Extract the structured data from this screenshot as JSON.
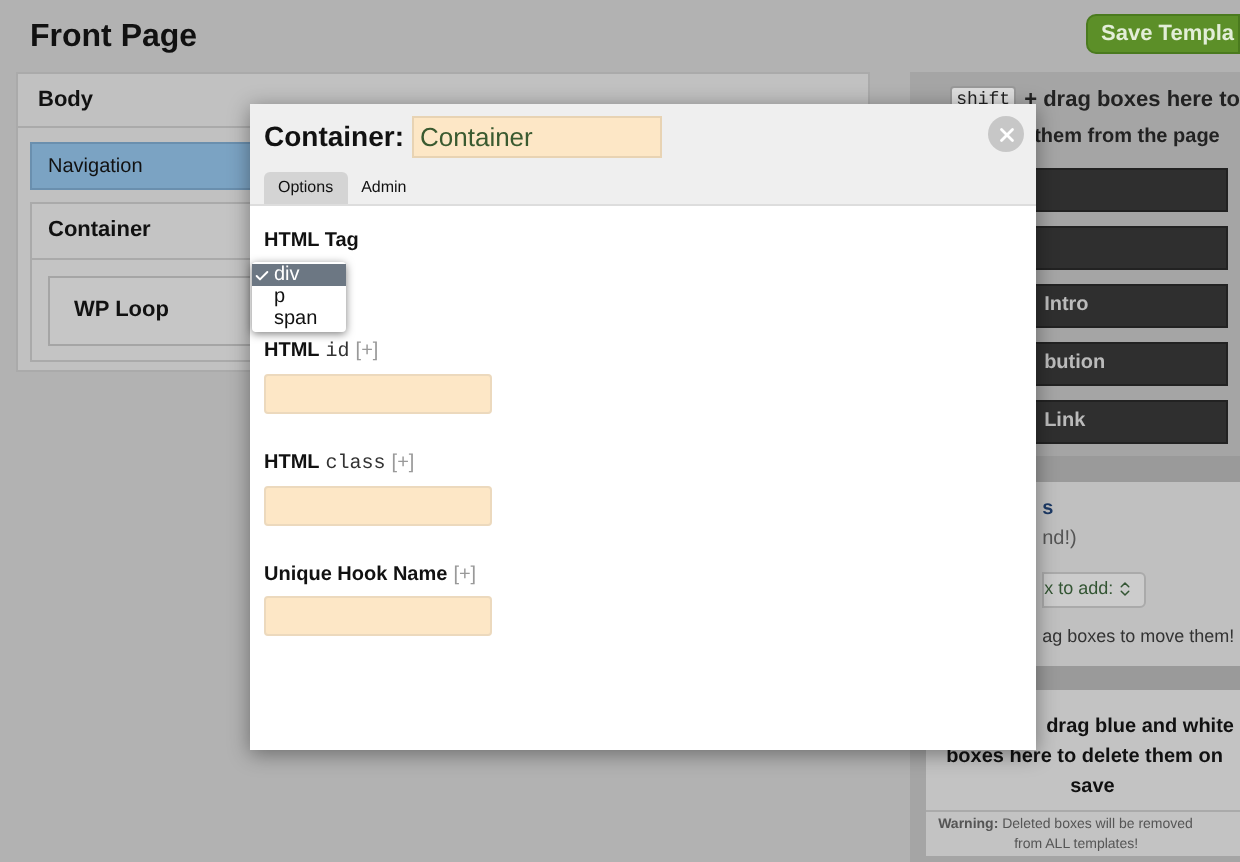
{
  "page": {
    "title": "Front Page",
    "save_button": "Save Templa"
  },
  "layout": {
    "body": "Body",
    "navigation": "Navigation",
    "container": "Container",
    "wp_loop": "WP Loop"
  },
  "sidebar": {
    "hint_key": "shift",
    "hint_line_1": "+ drag boxes here to",
    "hint_line_2": "them from the page",
    "boxes": [
      {
        "kind": "blank"
      },
      {
        "kind": "blank"
      },
      {
        "kind": "labeled",
        "label": "Intro"
      },
      {
        "kind": "labeled",
        "label": "bution"
      },
      {
        "kind": "labeled",
        "label": "Link"
      }
    ],
    "add_title": "s",
    "add_note": "nd!)",
    "add_select": "x to add:",
    "move_hint": "ag boxes to move them!",
    "trash_lines": [
      "drag blue and white",
      "boxes here to delete them on",
      "save"
    ],
    "warning_label": "Warning:",
    "warning_text": "Deleted boxes will be removed",
    "warning_text_2": "from ALL templates!"
  },
  "dialog": {
    "title": "Container:",
    "name_value": "Container",
    "tabs": [
      {
        "label": "Options",
        "selected": true
      },
      {
        "label": "Admin",
        "selected": false
      }
    ],
    "tag_label": "HTML Tag",
    "tag_options": [
      {
        "label": "div",
        "selected": true
      },
      {
        "label": "p",
        "selected": false
      },
      {
        "label": "span",
        "selected": false
      }
    ],
    "fields": [
      {
        "label": "HTML",
        "code": "id",
        "add": "[+]"
      },
      {
        "label": "HTML",
        "code": "class",
        "add": "[+]"
      },
      {
        "label": "Unique Hook Name",
        "add": "[+]"
      }
    ]
  }
}
